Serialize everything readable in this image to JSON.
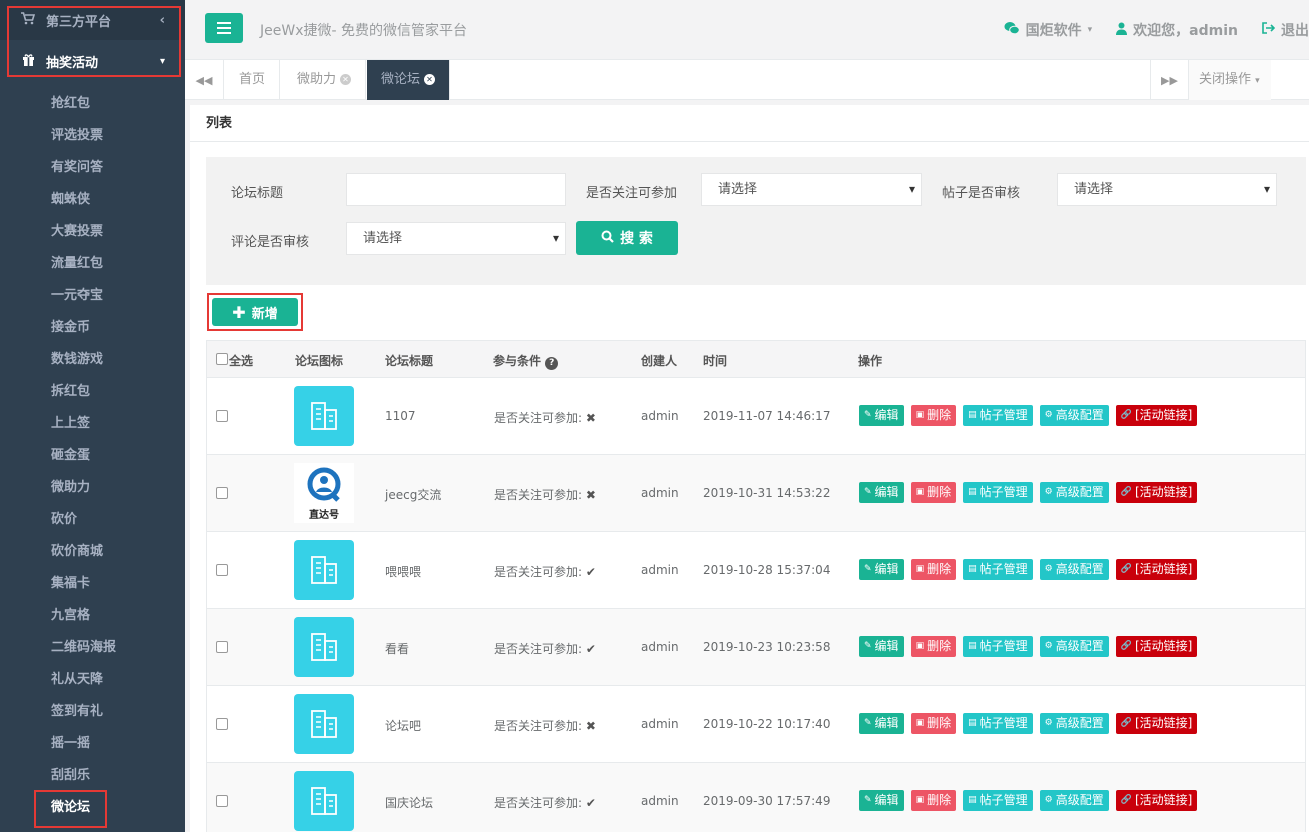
{
  "sidebar": {
    "groups": [
      {
        "label": "第三方平台",
        "icon": "cart-icon"
      },
      {
        "label": "抽奖活动",
        "icon": "gift-icon"
      }
    ],
    "items": [
      "抢红包",
      "评选投票",
      "有奖问答",
      "蜘蛛侠",
      "大赛投票",
      "流量红包",
      "一元夺宝",
      "接金币",
      "数钱游戏",
      "拆红包",
      "上上签",
      "砸金蛋",
      "微助力",
      "砍价",
      "砍价商城",
      "集福卡",
      "九宫格",
      "二维码海报",
      "礼从天降",
      "签到有礼",
      "摇一摇",
      "刮刮乐",
      "微论坛"
    ]
  },
  "header": {
    "title": "JeeWx捷微- 免费的微信管家平台",
    "company": "国炬软件",
    "welcome": "欢迎您，admin",
    "logout": "退出"
  },
  "tabs": [
    {
      "label": "首页"
    },
    {
      "label": "微助力"
    },
    {
      "label": "微论坛"
    }
  ],
  "close_ops": "关闭操作",
  "panel_title": "列表",
  "search": {
    "forum_title_label": "论坛标题",
    "forum_title_value": "",
    "follow_label": "是否关注可参加",
    "follow_value": "请选择",
    "post_review_label": "帖子是否审核",
    "post_review_value": "请选择",
    "comment_review_label": "评论是否审核",
    "comment_review_value": "请选择",
    "search_btn": "搜 索"
  },
  "add_btn": "新增",
  "table": {
    "headers": {
      "select_all": "全选",
      "icon": "论坛图标",
      "title": "论坛标题",
      "condition": "参与条件",
      "creator": "创建人",
      "time": "时间",
      "ops": "操作"
    },
    "ops": {
      "edit": "编辑",
      "delete": "删除",
      "posts": "帖子管理",
      "advanced": "高级配置",
      "link": "[活动链接]"
    },
    "condition_label": "是否关注可参加:",
    "rows": [
      {
        "title": "1107",
        "mark": "✖",
        "creator": "admin",
        "time": "2019-11-07 14:46:17",
        "icon": "default"
      },
      {
        "title": "jeecg交流",
        "mark": "✖",
        "creator": "admin",
        "time": "2019-10-31 14:53:22",
        "icon": "logo",
        "logo_text": "直达号"
      },
      {
        "title": "喂喂喂",
        "mark": "✔",
        "creator": "admin",
        "time": "2019-10-28 15:37:04",
        "icon": "default"
      },
      {
        "title": "看看",
        "mark": "✔",
        "creator": "admin",
        "time": "2019-10-23 10:23:58",
        "icon": "default"
      },
      {
        "title": "论坛吧",
        "mark": "✖",
        "creator": "admin",
        "time": "2019-10-22 10:17:40",
        "icon": "default"
      },
      {
        "title": "国庆论坛",
        "mark": "✔",
        "creator": "admin",
        "time": "2019-09-30 17:57:49",
        "icon": "default"
      }
    ]
  }
}
